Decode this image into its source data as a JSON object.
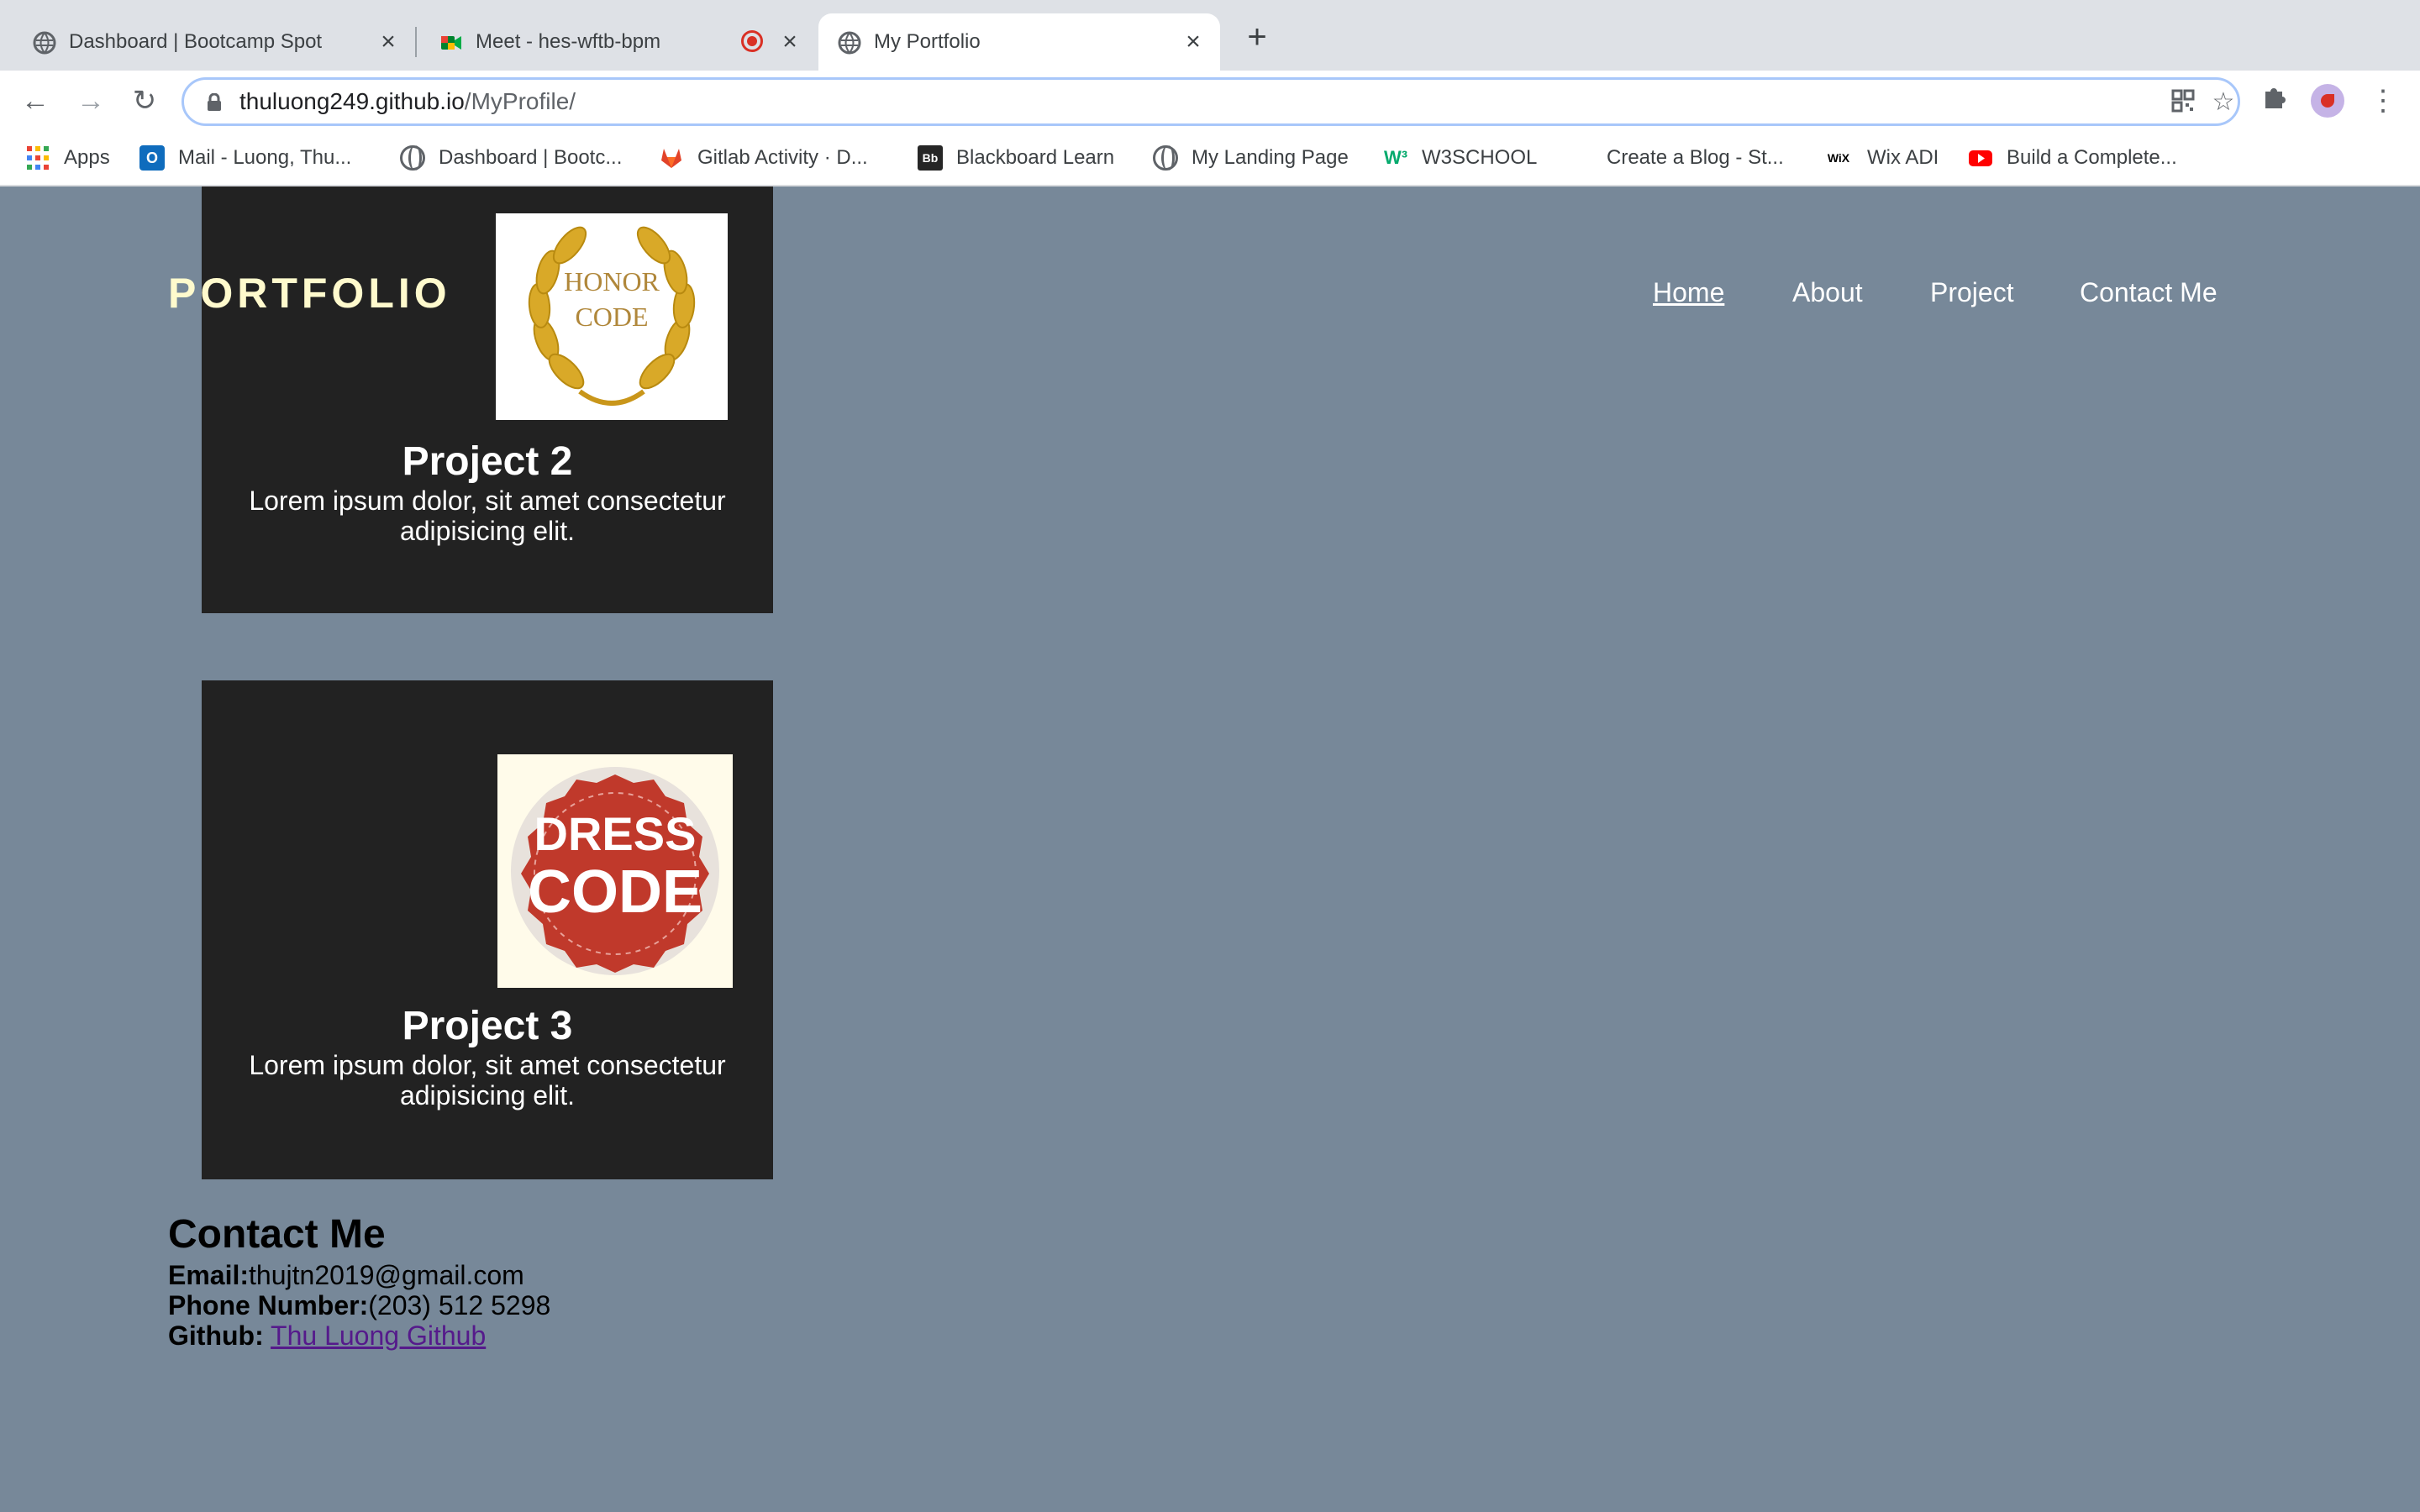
{
  "browser": {
    "tabs": [
      {
        "title": "Dashboard | Bootcamp Spot",
        "icon": "globe-icon"
      },
      {
        "title": "Meet - hes-wftb-bpm",
        "icon": "google-meet-icon"
      },
      {
        "title": "My Portfolio",
        "icon": "globe-icon",
        "active": true
      }
    ],
    "url": {
      "host": "thuluong249.github.io",
      "path": "/MyProfile/"
    },
    "bookmarks": [
      {
        "label": "Apps",
        "icon": "apps-grid-icon"
      },
      {
        "label": "Mail - Luong, Thu...",
        "icon": "outlook-icon"
      },
      {
        "label": "Dashboard | Bootc...",
        "icon": "globe-icon"
      },
      {
        "label": "Gitlab Activity · D...",
        "icon": "gitlab-icon"
      },
      {
        "label": "Blackboard Learn",
        "icon": "blackboard-icon"
      },
      {
        "label": "My Landing Page",
        "icon": "globe-icon"
      },
      {
        "label": "W3SCHOOL",
        "icon": "w3schools-icon"
      },
      {
        "label": "Create a Blog - St...",
        "icon": "blank-icon"
      },
      {
        "label": "Wix ADI",
        "icon": "wix-icon"
      },
      {
        "label": "Build a Complete...",
        "icon": "youtube-icon"
      }
    ]
  },
  "page": {
    "logo": "PORTFOLIO",
    "nav": [
      "Home",
      "About",
      "Project",
      "Contact Me"
    ],
    "projects": [
      {
        "title": "Project 2",
        "description": "Lorem ipsum dolor, sit amet consectetur adipisicing elit.",
        "image": {
          "line1": "HONOR",
          "line2": "CODE"
        }
      },
      {
        "title": "Project 3",
        "description": "Lorem ipsum dolor, sit amet consectetur adipisicing elit.",
        "image": {
          "line1": "DRESS",
          "line2": "CODE"
        }
      }
    ],
    "contact": {
      "title": "Contact Me",
      "email_label": "Email:",
      "email": "thujtn2019@gmail.com",
      "phone_label": "Phone Number:",
      "phone": "(203) 512 5298",
      "github_label": "Github:",
      "github_link": "Thu Luong Github"
    }
  },
  "colors": {
    "page_background": "#778899",
    "card_background": "#222222",
    "logo_color": "#fffacd",
    "visited_link": "#551a8b"
  }
}
